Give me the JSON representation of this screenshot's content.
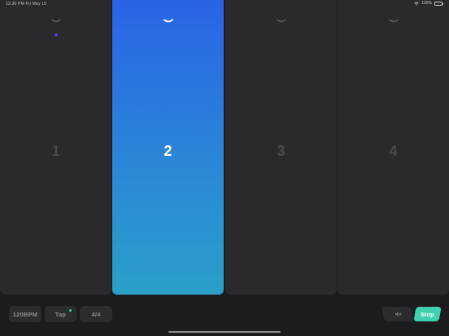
{
  "status_bar": {
    "time": "12:30 PM   Fri May 15",
    "battery": "100%",
    "icons": [
      "wifi-icon",
      "battery-icon"
    ]
  },
  "beats": [
    {
      "number": "1",
      "active": false,
      "accent": true
    },
    {
      "number": "2",
      "active": true,
      "accent": false
    },
    {
      "number": "3",
      "active": false,
      "accent": false
    },
    {
      "number": "4",
      "active": false,
      "accent": false
    }
  ],
  "controls": {
    "tempo": "120BPM",
    "tap": "Tap",
    "time_signature": "4/4",
    "mute_icon": "speaker-muted-icon",
    "stop": "Stop"
  },
  "colors": {
    "background": "#1c1c1e",
    "beat_inactive": "#2a2a2c",
    "beat_active_top": "#2a63e6",
    "beat_active_bottom": "#2aa0c8",
    "accent_dot": "#4b42e0",
    "stop_button": "#3fd0b0",
    "tap_indicator": "#2ed3a6"
  }
}
